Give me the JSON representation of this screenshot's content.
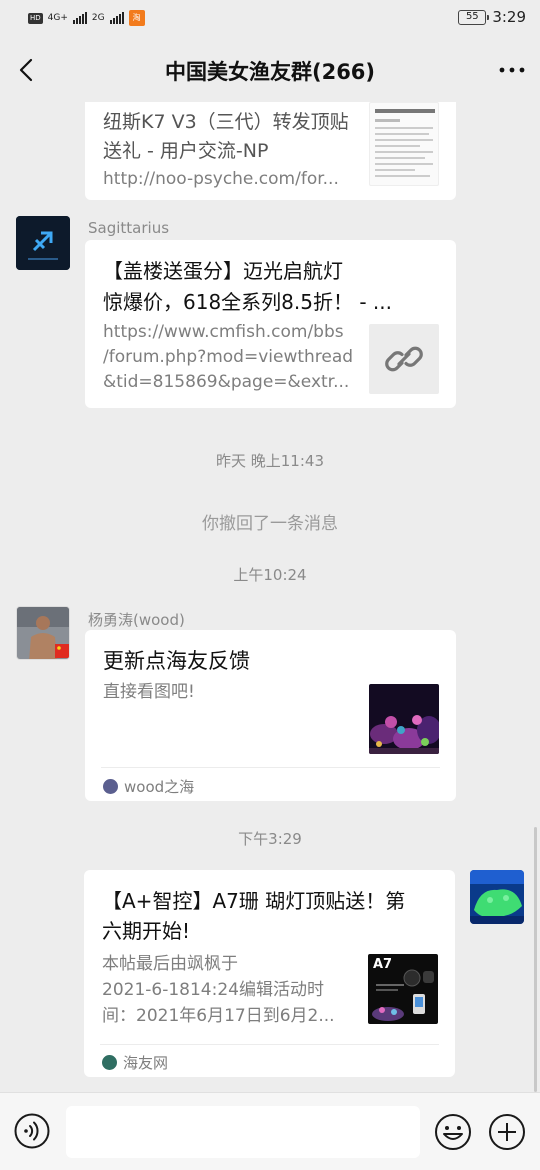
{
  "status_bar": {
    "hd": "HD",
    "net1": "4G+",
    "net2": "2G",
    "app_badge": "淘",
    "battery": "55",
    "time": "3:29"
  },
  "header": {
    "title": "中国美女渔友群(266)"
  },
  "messages": {
    "m1": {
      "title_line1": "纽斯K7 V3（三代）转发顶贴",
      "title_line2": "送礼 - 用户交流-NP",
      "url": "http://noo-psyche.com/for..."
    },
    "m2": {
      "sender": "Sagittarius",
      "title_line1": "【盖楼送蛋分】迈光启航灯",
      "title_line2": "惊爆价，618全系列8.5折！ - ...",
      "desc_line1": "https://www.cmfish.com/bbs",
      "desc_line2": "/forum.php?mod=viewthread",
      "desc_line3": "&tid=815869&page=&extr..."
    },
    "ts1": "昨天 晚上11:43",
    "recall": "你撤回了一条消息",
    "ts2": "上午10:24",
    "m3": {
      "sender": "杨勇涛(wood)",
      "title": "更新点海友反馈",
      "desc": "直接看图吧!",
      "source": "wood之海"
    },
    "ts3": "下午3:29",
    "m4": {
      "title_line1": "【A+智控】A7珊 瑚灯顶贴送！第",
      "title_line2": "六期开始!",
      "desc_line1": "本帖最后由飒枫于",
      "desc_line2": "2021-6-1814:24编辑活动时",
      "desc_line3": "间：2021年6月17日到6月2...",
      "thumb_label": "A7",
      "source": "海友网"
    }
  },
  "colors": {
    "background": "#ededed",
    "card": "#ffffff",
    "secondary_text": "#7e7e7e",
    "accent_blue": "#1d6fd6"
  }
}
